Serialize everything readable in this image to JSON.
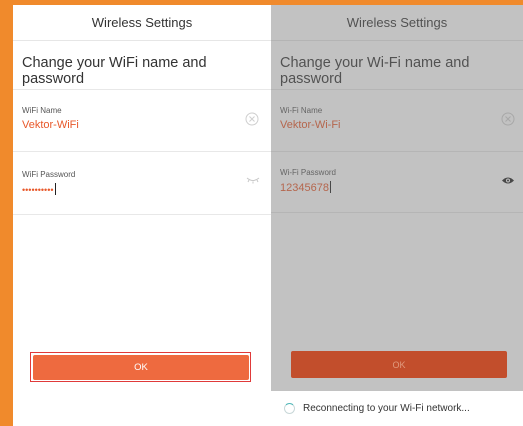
{
  "left": {
    "header_title": "Wireless Settings",
    "subtitle": "Change your WiFi name and password",
    "wifi_name": {
      "label": "WiFi Name",
      "value": "Vektor-WiFi"
    },
    "wifi_password": {
      "label": "WiFi Password",
      "value": "••••••••••"
    },
    "ok_label": "OK"
  },
  "right": {
    "header_title": "Wireless Settings",
    "subtitle": "Change your Wi-Fi name and password",
    "wifi_name": {
      "label": "Wi-Fi Name",
      "value": "Vektor-Wi-Fi"
    },
    "wifi_password": {
      "label": "Wi-Fi Password",
      "value": "12345678"
    },
    "ok_label": "OK",
    "status": "Reconnecting to your Wi-Fi network..."
  },
  "colors": {
    "frame": "#f08a2c",
    "accent": "#e8582a",
    "ok_button": "#ee6a3f",
    "highlight": "#e03a3a"
  },
  "icons": {
    "clear": "clear-circle-icon",
    "hide_password": "eye-closed-icon",
    "show_password": "eye-icon",
    "loading": "spinner-icon"
  }
}
